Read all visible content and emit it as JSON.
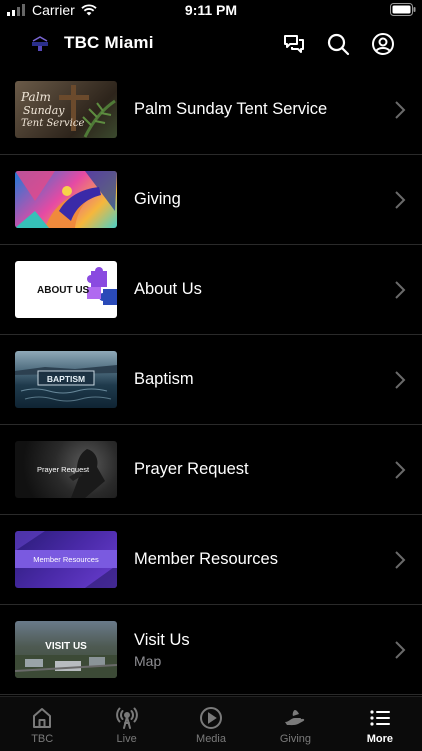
{
  "status_bar": {
    "carrier": "Carrier",
    "time": "9:11 PM"
  },
  "header": {
    "title": "TBC Miami",
    "icons": [
      "chat-bubbles-icon",
      "search-icon",
      "account-icon"
    ]
  },
  "items": [
    {
      "title": "Palm Sunday Tent Service",
      "subtitle": "",
      "thumb_text": "Palm Sunday Tent Service",
      "thumb_kind": "palm"
    },
    {
      "title": "Giving",
      "subtitle": "",
      "thumb_text": "",
      "thumb_kind": "giving"
    },
    {
      "title": "About Us",
      "subtitle": "",
      "thumb_text": "ABOUT US",
      "thumb_kind": "about"
    },
    {
      "title": "Baptism",
      "subtitle": "",
      "thumb_text": "BAPTISM",
      "thumb_kind": "baptism"
    },
    {
      "title": "Prayer Request",
      "subtitle": "",
      "thumb_text": "Prayer Request",
      "thumb_kind": "prayer"
    },
    {
      "title": "Member Resources",
      "subtitle": "",
      "thumb_text": "Member Resources",
      "thumb_kind": "member"
    },
    {
      "title": "Visit Us",
      "subtitle": "Map",
      "thumb_text": "VISIT US",
      "thumb_kind": "visit"
    }
  ],
  "tabs": [
    {
      "label": "TBC",
      "icon": "home-icon",
      "active": false
    },
    {
      "label": "Live",
      "icon": "broadcast-icon",
      "active": false
    },
    {
      "label": "Media",
      "icon": "play-circle-icon",
      "active": false
    },
    {
      "label": "Giving",
      "icon": "giving-hand-icon",
      "active": false
    },
    {
      "label": "More",
      "icon": "list-icon",
      "active": true
    }
  ],
  "colors": {
    "background": "#000000",
    "text": "#ffffff",
    "secondary_text": "#8e8e93",
    "separator": "#2a2a2a",
    "tab_inactive": "#7a7a7a"
  }
}
